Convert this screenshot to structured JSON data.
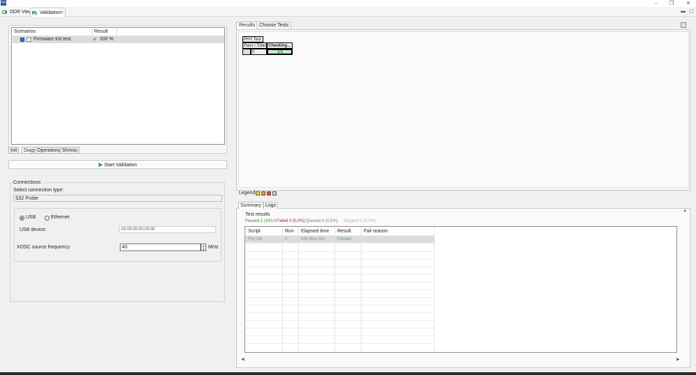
{
  "window": {
    "icon_label": "NX"
  },
  "editor_tabs": [
    {
      "label": "DDR View"
    },
    {
      "label": "Validation"
    }
  ],
  "scenarios": {
    "columns": [
      "Scenarios",
      "Result"
    ],
    "rows": [
      {
        "name": "Firmware Init test",
        "result": "100 %",
        "checked": true
      }
    ]
  },
  "left_tabs": [
    "Init",
    "Diags",
    "Operational",
    "Shmoo"
  ],
  "start_button": "Start Validation",
  "connections": {
    "title": "Connections:",
    "type_label": "Select connection type:",
    "type_value": "S32 Probe",
    "usb_label": "USB",
    "ethernet_label": "Ethernet",
    "selected": "USB",
    "usb_device_label": "USB device:",
    "usb_device_value": "00:00:00:00:00:00",
    "xosc_label": "XOSC source frequency:",
    "xosc_value": "40",
    "xosc_unit": "MHz"
  },
  "results_tabs": [
    "Results",
    "Choose Tests"
  ],
  "phy_table": {
    "title": "PHY Test",
    "col1": "Pass / Total",
    "col2": "Checking...",
    "pass_value": "0",
    "checking_value": "1/1"
  },
  "legend": {
    "label": "Legend:",
    "colors": [
      "#e8d84a",
      "#e89a3a",
      "#d84a4a",
      "#b0e0e0"
    ]
  },
  "summary_tabs": [
    "Summary",
    "Logs"
  ],
  "test_results": {
    "title": "Test results",
    "passed": "Passed 1 (100,0",
    "failed": "Failed 0 (0,0%)",
    "queued": "Queued 0 (0,0%)",
    "skipped": "Skipped 0 (0,0%)",
    "columns": [
      "Script",
      "Run",
      "Elapsed time",
      "Result",
      "Fail reason"
    ],
    "rows": [
      {
        "script": "Phy Init",
        "run": "1",
        "elapsed": "00h 00m 34s",
        "result": "Passed",
        "fail_reason": ""
      }
    ]
  }
}
